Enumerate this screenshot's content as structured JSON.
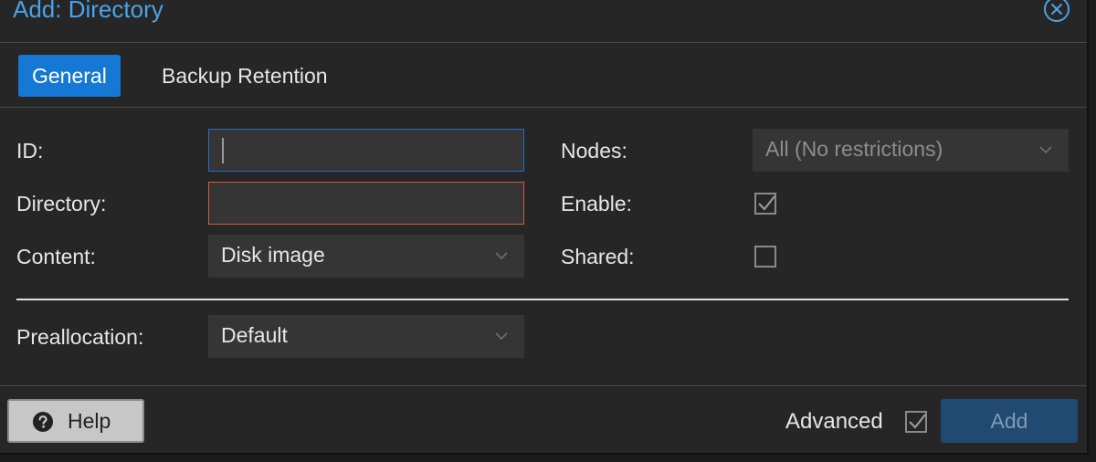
{
  "window": {
    "title": "Add: Directory"
  },
  "tabs": [
    {
      "label": "General",
      "active": true
    },
    {
      "label": "Backup Retention",
      "active": false
    }
  ],
  "form": {
    "id": {
      "label": "ID:",
      "value": ""
    },
    "directory": {
      "label": "Directory:",
      "value": ""
    },
    "content": {
      "label": "Content:",
      "value": "Disk image"
    },
    "nodes": {
      "label": "Nodes:",
      "value": "All (No restrictions)"
    },
    "enable": {
      "label": "Enable:",
      "checked": true
    },
    "shared": {
      "label": "Shared:",
      "checked": false
    },
    "preallocation": {
      "label": "Preallocation:",
      "value": "Default"
    }
  },
  "footer": {
    "help_label": "Help",
    "advanced_label": "Advanced",
    "advanced_checked": true,
    "add_label": "Add"
  },
  "colors": {
    "accent": "#1478d4",
    "title": "#4aa3e8",
    "error": "#d45a3c",
    "focus": "#1f70c4"
  }
}
